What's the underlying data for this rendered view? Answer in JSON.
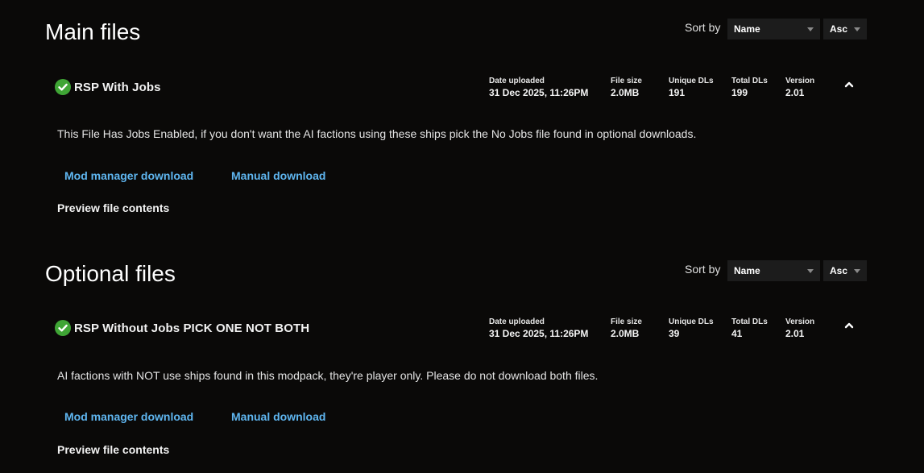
{
  "sections": [
    {
      "title": "Main files",
      "sort_label": "Sort by",
      "sort_field": "Name",
      "sort_order": "Asc",
      "file": {
        "name": "RSP With Jobs",
        "date_label": "Date uploaded",
        "date_value": "31 Dec 2025, 11:26PM",
        "size_label": "File size",
        "size_value": "2.0MB",
        "unique_label": "Unique DLs",
        "unique_value": "191",
        "total_label": "Total DLs",
        "total_value": "199",
        "version_label": "Version",
        "version_value": "2.01",
        "description": "This File Has Jobs Enabled, if you don't want the AI factions using these ships pick the No Jobs file found in optional downloads.",
        "mod_manager_label": "Mod manager download",
        "manual_label": "Manual download",
        "preview_label": "Preview file contents"
      }
    },
    {
      "title": "Optional files",
      "sort_label": "Sort by",
      "sort_field": "Name",
      "sort_order": "Asc",
      "file": {
        "name": "RSP Without Jobs PICK ONE NOT BOTH",
        "date_label": "Date uploaded",
        "date_value": "31 Dec 2025, 11:26PM",
        "size_label": "File size",
        "size_value": "2.0MB",
        "unique_label": "Unique DLs",
        "unique_value": "39",
        "total_label": "Total DLs",
        "total_value": "41",
        "version_label": "Version",
        "version_value": "2.01",
        "description": "AI factions with NOT use ships found in this modpack, they're player only. Please do not download both files.",
        "mod_manager_label": "Mod manager download",
        "manual_label": "Manual download",
        "preview_label": "Preview file contents"
      }
    }
  ],
  "colors": {
    "background": "#0a0908",
    "link": "#5fb6f0",
    "check": "#3fa535"
  },
  "icons": {
    "status": "check-circle-icon",
    "collapse": "chevron-up-icon",
    "dropdown": "caret-down-icon"
  }
}
